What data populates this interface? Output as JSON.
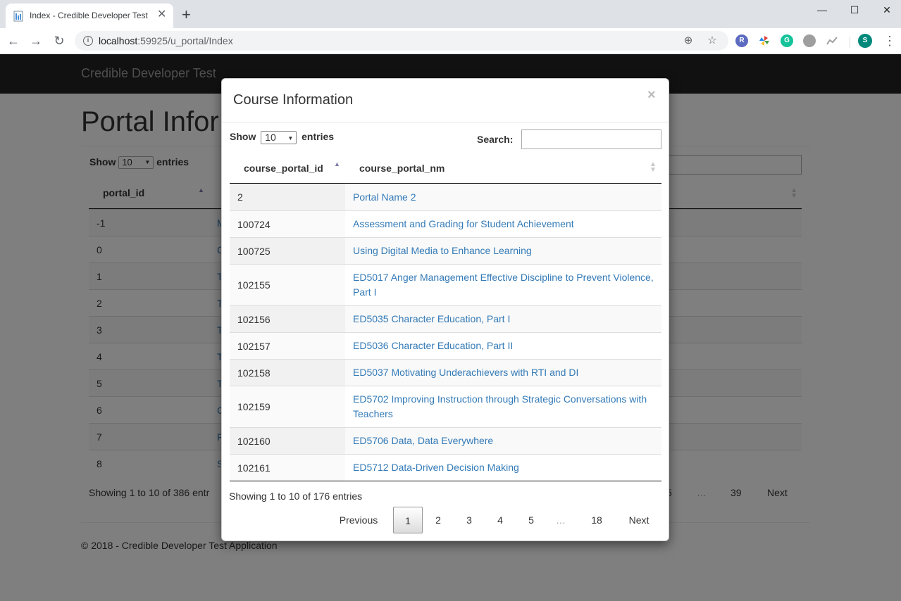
{
  "browser": {
    "tab_title": "Index - Credible Developer Test",
    "new_tab_glyph": "+",
    "url_host": "localhost",
    "url_path": ":59925/u_portal/Index",
    "profile_initial": "S",
    "extensions": [
      {
        "name": "r-extension-icon",
        "letter": "R",
        "color": "#5c6bc0"
      },
      {
        "name": "pinwheel-extension-icon",
        "letter": "",
        "color": "#e53935"
      },
      {
        "name": "grammarly-icon",
        "letter": "G",
        "color": "#15c39a"
      },
      {
        "name": "circle-extension-icon",
        "letter": "",
        "color": "#9e9e9e"
      },
      {
        "name": "chart-extension-icon",
        "letter": "",
        "color": "#bdbdbd"
      }
    ]
  },
  "page": {
    "brand": "Credible Developer Test",
    "heading": "Portal Infor",
    "show_label": "Show",
    "show_value": "10",
    "entries_label": "entries",
    "column1": "portal_id",
    "rows": [
      {
        "id": "-1",
        "link": "M"
      },
      {
        "id": "0",
        "link": "C"
      },
      {
        "id": "1",
        "link": "T"
      },
      {
        "id": "2",
        "link": "T"
      },
      {
        "id": "3",
        "link": "T"
      },
      {
        "id": "4",
        "link": "T"
      },
      {
        "id": "5",
        "link": "T"
      },
      {
        "id": "6",
        "link": "C"
      },
      {
        "id": "7",
        "link": "F"
      },
      {
        "id": "8",
        "link": "S"
      }
    ],
    "info": "Showing 1 to 10 of 386 entr",
    "pagination": [
      "5",
      "…",
      "39",
      "Next"
    ],
    "footer": "© 2018 - Credible Developer Test Application"
  },
  "modal": {
    "title": "Course Information",
    "close_glyph": "×",
    "show_label": "Show",
    "show_value": "10",
    "entries_label": "entries",
    "search_label": "Search:",
    "search_value": "",
    "columns": [
      "course_portal_id",
      "course_portal_nm"
    ],
    "rows": [
      {
        "id": "2",
        "name": "Portal Name 2"
      },
      {
        "id": "100724",
        "name": "Assessment and Grading for Student Achievement"
      },
      {
        "id": "100725",
        "name": "Using Digital Media to Enhance Learning"
      },
      {
        "id": "102155",
        "name": "ED5017 Anger Management Effective Discipline to Prevent Violence, Part I"
      },
      {
        "id": "102156",
        "name": "ED5035 Character Education, Part I"
      },
      {
        "id": "102157",
        "name": "ED5036 Character Education, Part II"
      },
      {
        "id": "102158",
        "name": "ED5037 Motivating Underachievers with RTI and DI"
      },
      {
        "id": "102159",
        "name": "ED5702 Improving Instruction through Strategic Conversations with Teachers"
      },
      {
        "id": "102160",
        "name": "ED5706 Data, Data Everywhere"
      },
      {
        "id": "102161",
        "name": "ED5712 Data-Driven Decision Making"
      }
    ],
    "info": "Showing 1 to 10 of 176 entries",
    "pagination": {
      "previous": "Previous",
      "pages": [
        "1",
        "2",
        "3",
        "4",
        "5"
      ],
      "ellipsis": "…",
      "last": "18",
      "next": "Next",
      "current": "1"
    }
  }
}
